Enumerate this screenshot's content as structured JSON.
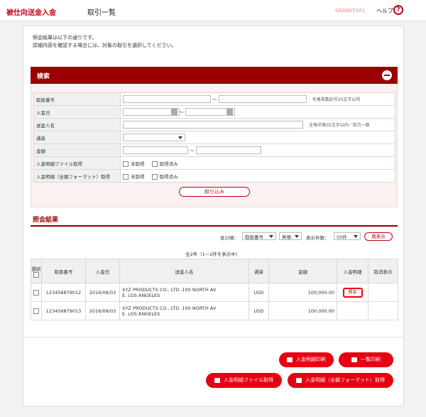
{
  "header": {
    "title": "被仕向送金入金",
    "subtitle": "取引一覧",
    "screen_id": "GRAN05101",
    "help_label": "ヘルプ",
    "help_icon": "?"
  },
  "info": {
    "line1": "照会結果は以下の通りです。",
    "line2": "詳細内容を確認する場合には、対象の取引を選択してください。"
  },
  "search": {
    "title": "検索",
    "tilde": "～",
    "rows": {
      "trade_no": {
        "label": "取扱番号",
        "hint": "半角英数記号20文字以内"
      },
      "date": {
        "label": "入金日"
      },
      "remitter": {
        "label": "送金人名",
        "hint": "全角半角35文字以内／前方一致"
      },
      "currency": {
        "label": "通貨"
      },
      "amount": {
        "label": "金額"
      },
      "file": {
        "label": "入金明細ファイル取得",
        "opt1": "未取得",
        "opt2": "取得済み"
      },
      "file_full": {
        "label": "入金明細（全銀フォーマット）取得",
        "opt1": "未取得",
        "opt2": "取得済み"
      }
    },
    "narrow_button": "絞り込み"
  },
  "results": {
    "title": "照会結果",
    "sort_label": "並び順：",
    "sort_key": "取扱番号",
    "sort_order": "昇順",
    "page_size_label": "表示件数：",
    "page_size": "50件",
    "redisplay": "再表示",
    "count_text": "全2件（1～2件を表示中）",
    "columns": {
      "select": "選択",
      "trade_no": "取扱番号",
      "date": "入金日",
      "remitter": "送金人名",
      "currency": "通貨",
      "amount": "金額",
      "detail": "入金明細",
      "cancel": "取消表示"
    },
    "rows": [
      {
        "trade_no": "123456879012",
        "date": "2016/08/03",
        "remitter1": "XYZ PRODUCTS CO., LTD. 100 NORTH AV",
        "remitter2": "E. LOS ANGELES",
        "currency": "USD",
        "amount": "100,000.00",
        "detail": "照会"
      },
      {
        "trade_no": "123456879013",
        "date": "2016/08/03",
        "remitter1": "XYZ PRODUCTS CO., LTD. 100 NORTH AV",
        "remitter2": "E. LOS ANGELES",
        "currency": "USD",
        "amount": "100,000.00",
        "detail": ""
      }
    ]
  },
  "actions": {
    "print_detail": "入金明細印刷",
    "print_list": "一覧印刷",
    "get_file": "入金明細ファイル取得",
    "get_file_full": "入金明細（全銀フォーマット）取得"
  },
  "colors": {
    "brand": "#c4001a",
    "section": "#9b0000",
    "button": "#e60012"
  }
}
